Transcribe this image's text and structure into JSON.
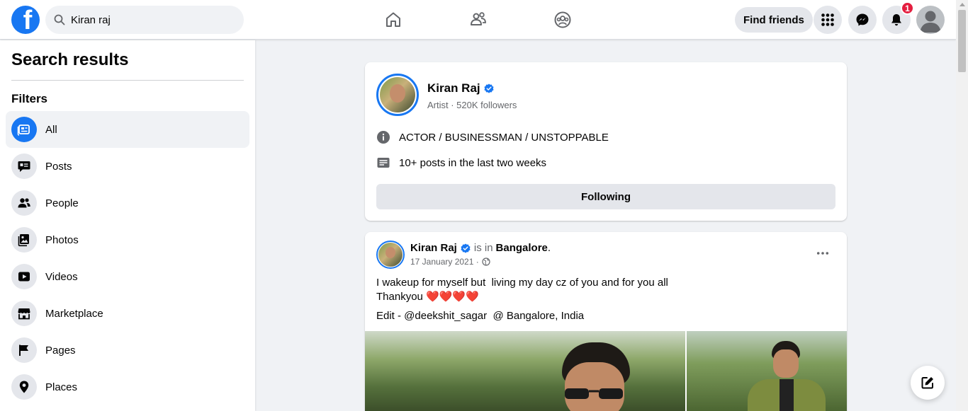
{
  "topbar": {
    "logo_letter": "f",
    "search_value": "Kiran raj",
    "find_friends_label": "Find friends",
    "notification_count": "1"
  },
  "sidebar": {
    "title": "Search results",
    "filters_label": "Filters",
    "items": [
      {
        "label": "All",
        "icon": "feed-icon"
      },
      {
        "label": "Posts",
        "icon": "posts-icon"
      },
      {
        "label": "People",
        "icon": "people-icon"
      },
      {
        "label": "Photos",
        "icon": "photos-icon"
      },
      {
        "label": "Videos",
        "icon": "videos-icon"
      },
      {
        "label": "Marketplace",
        "icon": "marketplace-icon"
      },
      {
        "label": "Pages",
        "icon": "pages-flag-icon"
      },
      {
        "label": "Places",
        "icon": "location-pin-icon"
      }
    ]
  },
  "profile": {
    "name": "Kiran Raj",
    "subtitle": "Artist · 520K followers",
    "bio": "ACTOR / BUSINESSMAN / UNSTOPPABLE",
    "activity": "10+ posts in the last two weeks",
    "following_label": "Following"
  },
  "post": {
    "author": "Kiran Raj",
    "is_in": "is in",
    "place": "Bangalore",
    "date": "17 January 2021 ·",
    "line1": "I wakeup for myself but  living my day cz of you and for you all",
    "line2": "Thankyou ❤️❤️❤️❤️",
    "edit_line": "Edit - @deekshit_sagar  @ Bangalore, India"
  },
  "colors": {
    "brand": "#1877f2",
    "badge": "#e41e3f"
  }
}
